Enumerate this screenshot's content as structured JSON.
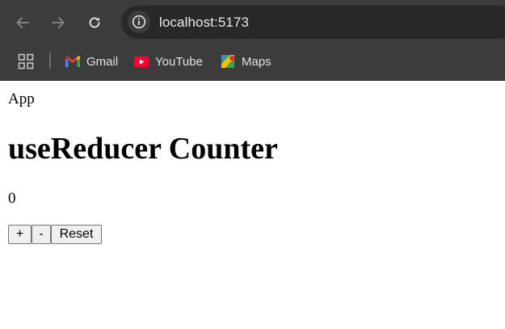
{
  "browser": {
    "url": "localhost:5173",
    "bookmarks": [
      {
        "label": "Gmail",
        "icon": "gmail-icon"
      },
      {
        "label": "YouTube",
        "icon": "youtube-icon"
      },
      {
        "label": "Maps",
        "icon": "maps-icon"
      }
    ],
    "colors": {
      "chrome_bg": "#3c3c3c",
      "omnibox_bg": "#282828",
      "text": "#e3e3e3"
    }
  },
  "page": {
    "app_label": "App",
    "heading": "useReducer Counter",
    "count": "0",
    "buttons": {
      "increment": "+",
      "decrement": "-",
      "reset": "Reset"
    }
  }
}
